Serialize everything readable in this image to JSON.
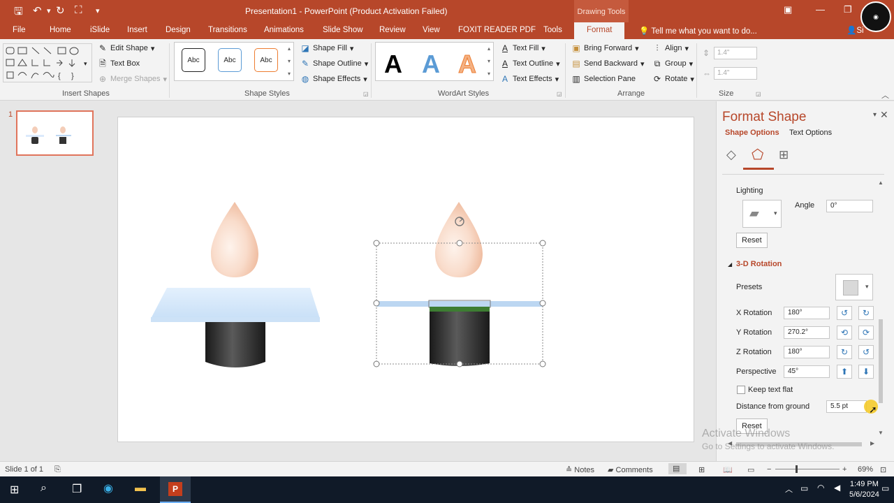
{
  "window": {
    "title": "Presentation1 - PowerPoint (Product Activation Failed)",
    "context_tab_group": "Drawing Tools"
  },
  "tabs": [
    "File",
    "Home",
    "iSlide",
    "Insert",
    "Design",
    "Transitions",
    "Animations",
    "Slide Show",
    "Review",
    "View",
    "FOXIT READER PDF",
    "Tools",
    "Format"
  ],
  "tell_me": "Tell me what you want to do...",
  "sign_in": "Si",
  "ribbon": {
    "insert_shapes": {
      "label": "Insert Shapes",
      "edit_shape": "Edit Shape",
      "text_box": "Text Box",
      "merge_shapes": "Merge Shapes"
    },
    "shape_styles": {
      "label": "Shape Styles",
      "sample": "Abc",
      "shape_fill": "Shape Fill",
      "shape_outline": "Shape Outline",
      "shape_effects": "Shape Effects"
    },
    "wordart_styles": {
      "label": "WordArt Styles",
      "letter": "A",
      "text_fill": "Text Fill",
      "text_outline": "Text Outline",
      "text_effects": "Text Effects"
    },
    "arrange": {
      "label": "Arrange",
      "bring_forward": "Bring Forward",
      "send_backward": "Send Backward",
      "selection_pane": "Selection Pane",
      "align": "Align",
      "group": "Group",
      "rotate": "Rotate"
    },
    "size": {
      "label": "Size",
      "height": "1.4\"",
      "width": "1.4\""
    }
  },
  "thumbs": {
    "slide_number": "1"
  },
  "format_pane": {
    "title": "Format Shape",
    "tab_shape_options": "Shape Options",
    "tab_text_options": "Text Options",
    "lighting_label": "Lighting",
    "angle_label": "Angle",
    "angle_value": "0°",
    "reset_label": "Reset",
    "rotation_section": "3-D Rotation",
    "presets_label": "Presets",
    "x_rotation_label": "X Rotation",
    "x_rotation_value": "180°",
    "y_rotation_label": "Y Rotation",
    "y_rotation_value": "270.2°",
    "z_rotation_label": "Z Rotation",
    "z_rotation_value": "180°",
    "perspective_label": "Perspective",
    "perspective_value": "45°",
    "keep_text_flat_label": "Keep text flat",
    "distance_label": "Distance from ground",
    "distance_value": "5.5 pt",
    "reset2_label": "Reset"
  },
  "watermark": {
    "line1": "Activate Windows",
    "line2": "Go to Settings to activate Windows."
  },
  "status": {
    "slide_info": "Slide 1 of 1",
    "notes": "Notes",
    "comments": "Comments",
    "zoom": "69%"
  },
  "taskbar": {
    "time": "1:49 PM",
    "date": "5/6/2024"
  },
  "colors": {
    "accent": "#b7472a",
    "ribbon_bg": "#f3f3f3",
    "taskbar": "#101a28"
  }
}
